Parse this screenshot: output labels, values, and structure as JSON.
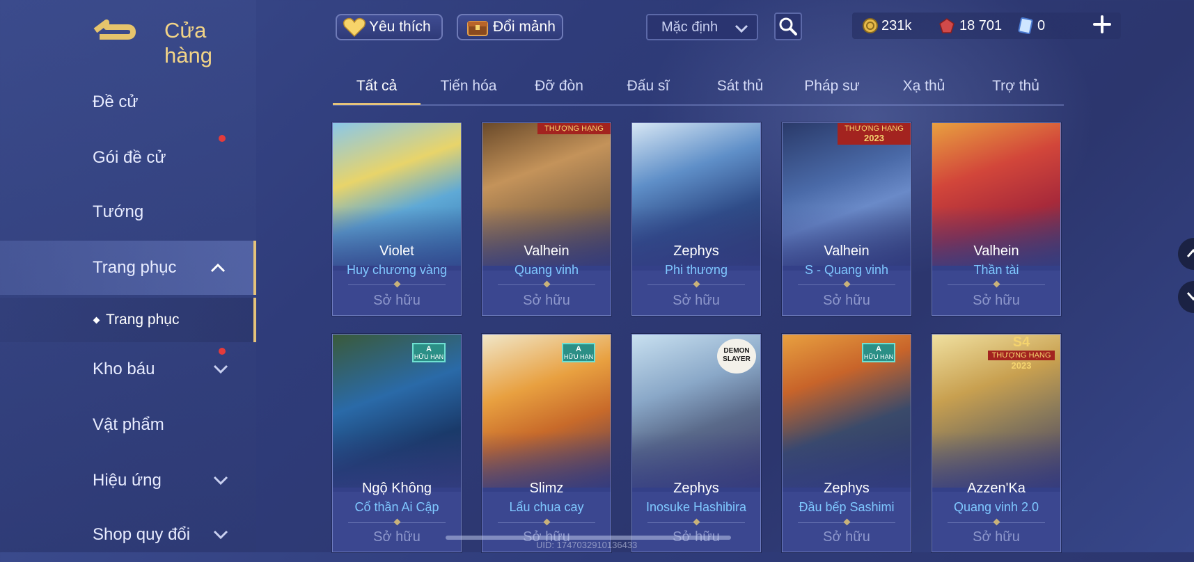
{
  "header": {
    "title": "Cửa hàng",
    "favorites_label": "Yêu thích",
    "exchange_label": "Đổi mảnh",
    "sort_value": "Mặc định"
  },
  "currency": {
    "gold": "231k",
    "ruby": "18 701",
    "voucher": "0"
  },
  "sidebar": {
    "items": [
      {
        "label": "Đề cử"
      },
      {
        "label": "Gói đề cử"
      },
      {
        "label": "Tướng"
      },
      {
        "label": "Trang phục"
      },
      {
        "label": "Kho báu"
      },
      {
        "label": "Vật phẩm"
      },
      {
        "label": "Hiệu ứng"
      },
      {
        "label": "Shop quy đổi"
      }
    ],
    "sub_item": "Trang phục"
  },
  "tabs": [
    "Tất cả",
    "Tiến hóa",
    "Đỡ đòn",
    "Đấu sĩ",
    "Sát thủ",
    "Pháp sư",
    "Xạ thủ",
    "Trợ thủ"
  ],
  "cards": [
    {
      "hero": "Violet",
      "skin": "Huy chương vàng",
      "status": "Sở hữu"
    },
    {
      "hero": "Valhein",
      "skin": "Quang vinh",
      "status": "Sở hữu",
      "banner": "THƯỢNG HẠNG"
    },
    {
      "hero": "Zephys",
      "skin": "Phi thương",
      "status": "Sở hữu"
    },
    {
      "hero": "Valhein",
      "skin": "S - Quang vinh",
      "status": "Sở hữu",
      "banner": "THƯỢNG HẠNG",
      "banner_year": "2023"
    },
    {
      "hero": "Valhein",
      "skin": "Thần tài",
      "status": "Sở hữu"
    },
    {
      "hero": "Ngộ Không",
      "skin": "Cổ thần Ai Cập",
      "status": "Sở hữu",
      "badge_grade": "A",
      "badge_text": "HỮU HẠN"
    },
    {
      "hero": "Slimz",
      "skin": "Lẩu chua cay",
      "status": "Sở hữu",
      "badge_grade": "A",
      "badge_text": "HỮU HẠN"
    },
    {
      "hero": "Zephys",
      "skin": "Inosuke Hashibira",
      "status": "Sở hữu",
      "logo_text": "DEMON SLAYER"
    },
    {
      "hero": "Zephys",
      "skin": "Đầu bếp Sashimi",
      "status": "Sở hữu",
      "badge_grade": "A",
      "badge_text": "HỮU HẠN"
    },
    {
      "hero": "Azzen'Ka",
      "skin": "Quang vinh 2.0",
      "status": "Sở hữu",
      "rank_season": "S4",
      "rank_label": "THƯỢNG HẠNG",
      "rank_year": "2023"
    }
  ],
  "footer": {
    "uid": "UID: 1747032910136433"
  },
  "colors": {
    "accent_gold": "#e5c37a",
    "skin_name_blue": "#7fc8ff",
    "background": "#2f3c7a"
  }
}
